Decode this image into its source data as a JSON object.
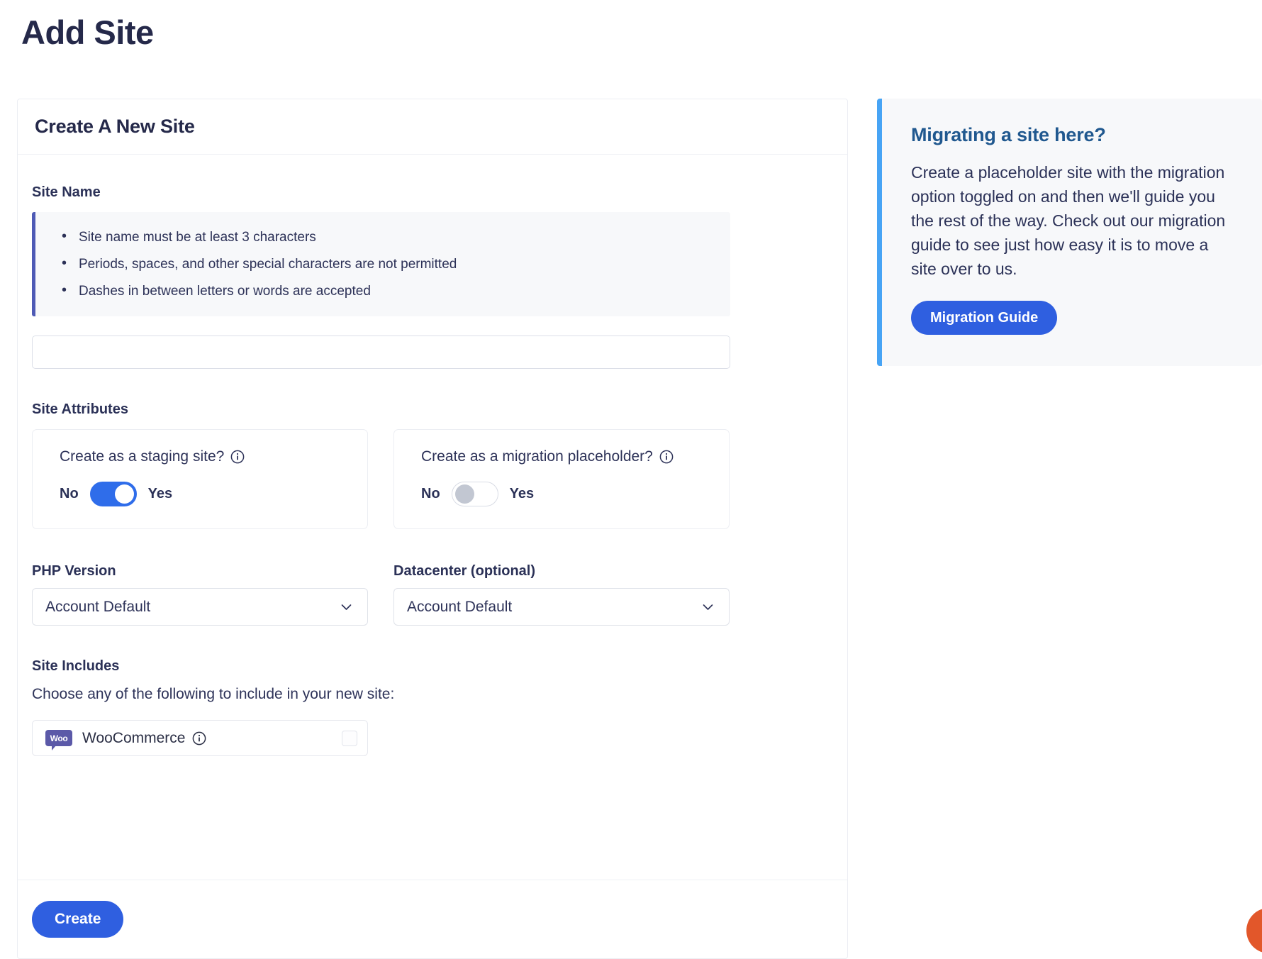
{
  "page": {
    "title": "Add Site"
  },
  "main_card": {
    "header_title": "Create A New Site",
    "site_name": {
      "label": "Site Name",
      "rules": [
        "Site name must be at least 3 characters",
        "Periods, spaces, and other special characters are not permitted",
        "Dashes in between letters or words are accepted"
      ],
      "input_value": "",
      "input_placeholder": ""
    },
    "site_attributes": {
      "label": "Site Attributes",
      "options": [
        {
          "question": "Create as a staging site?",
          "info_icon": "info-circle-icon",
          "off_label": "No",
          "on_label": "Yes",
          "state": "on"
        },
        {
          "question": "Create as a migration placeholder?",
          "info_icon": "info-circle-icon",
          "off_label": "No",
          "on_label": "Yes",
          "state": "off"
        }
      ]
    },
    "php_version": {
      "label": "PHP Version",
      "selected": "Account Default",
      "chevron_icon": "chevron-down-icon"
    },
    "datacenter": {
      "label": "Datacenter (optional)",
      "selected": "Account Default",
      "chevron_icon": "chevron-down-icon"
    },
    "site_includes": {
      "label": "Site Includes",
      "help_text": "Choose any of the following to include in your new site:",
      "items": [
        {
          "logo": "woocommerce-logo",
          "logo_text": "Woo",
          "name": "WooCommerce",
          "info_icon": "info-circle-icon",
          "checked": false
        }
      ]
    },
    "footer": {
      "create_label": "Create"
    }
  },
  "side_panel": {
    "title": "Migrating a site here?",
    "body": "Create a placeholder site with the migration option toggled on and then we'll guide you the rest of the way. Check out our migration guide to see just how easy it is to move a site over to us.",
    "button_label": "Migration Guide"
  },
  "colors": {
    "accent_blue": "#2f5fe0",
    "toggle_on": "#2f6dea",
    "side_accent": "#47a4f5",
    "rules_accent": "#4e5ab5",
    "heading": "#25294a",
    "side_title": "#20588f",
    "woo_purple": "#5b59a8",
    "help_bubble": "#e2572a"
  },
  "help_widget": {
    "icon": "help-chat-bubble-icon"
  }
}
